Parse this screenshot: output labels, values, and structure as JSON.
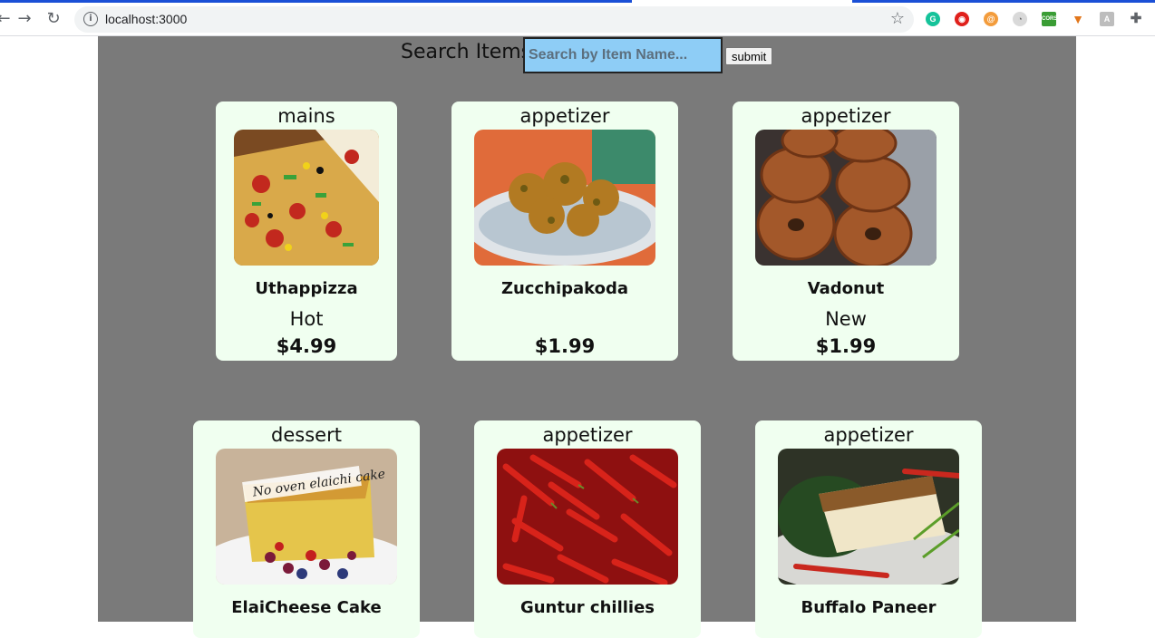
{
  "browser": {
    "url": "localhost:3000"
  },
  "search": {
    "label": "Search Items:",
    "placeholder": "Search by Item Name...",
    "submit_label": "submit"
  },
  "dishes": [
    {
      "category": "mains",
      "name": "Uthappizza",
      "label": "Hot",
      "price": "$4.99",
      "image": "pizza"
    },
    {
      "category": "appetizer",
      "name": "Zucchipakoda",
      "label": "",
      "price": "$1.99",
      "image": "pakoda"
    },
    {
      "category": "appetizer",
      "name": "Vadonut",
      "label": "New",
      "price": "$1.99",
      "image": "donut"
    },
    {
      "category": "dessert",
      "name": "ElaiCheese Cake",
      "label": "",
      "price": "",
      "image": "cake"
    },
    {
      "category": "appetizer",
      "name": "Guntur chillies",
      "label": "",
      "price": "",
      "image": "chillies"
    },
    {
      "category": "appetizer",
      "name": "Buffalo Paneer",
      "label": "",
      "price": "",
      "image": "paneer"
    }
  ],
  "image_caption": "No oven elaichi cake"
}
